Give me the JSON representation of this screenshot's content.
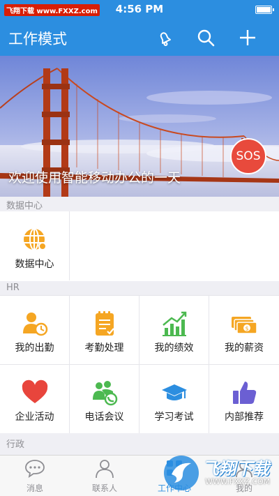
{
  "status_bar": {
    "carrier": "飞翔下载 www.FXXZ.com",
    "time": "4:56 PM",
    "battery_level": 1.0
  },
  "nav": {
    "title": "工作模式"
  },
  "banner": {
    "caption": "欢迎使用智能移动办公的一天",
    "sos_label": "SOS"
  },
  "sections": {
    "data_center": {
      "label": "数据中心",
      "items": [
        {
          "label": "数据中心",
          "icon": "globe-icon"
        }
      ]
    },
    "hr": {
      "label": "HR",
      "items": [
        {
          "label": "我的出勤",
          "icon": "attendance-icon"
        },
        {
          "label": "考勤处理",
          "icon": "clipboard-icon"
        },
        {
          "label": "我的绩效",
          "icon": "growth-chart-icon"
        },
        {
          "label": "我的薪资",
          "icon": "money-icon"
        },
        {
          "label": "企业活动",
          "icon": "heart-icon"
        },
        {
          "label": "电话会议",
          "icon": "conference-icon"
        },
        {
          "label": "学习考试",
          "icon": "graduation-cap-icon"
        },
        {
          "label": "内部推荐",
          "icon": "thumbs-up-icon"
        }
      ]
    },
    "admin": {
      "label": "行政"
    }
  },
  "tabs": [
    {
      "label": "消息",
      "icon": "chat-icon",
      "active": false
    },
    {
      "label": "联系人",
      "icon": "contact-icon",
      "active": false
    },
    {
      "label": "工作中心",
      "icon": "work-icon",
      "active": true
    },
    {
      "label": "我的",
      "icon": "profile-icon",
      "active": false
    }
  ],
  "watermark": {
    "text": "飞翔下载",
    "url": "WWW.FXXZ.COM"
  },
  "colors": {
    "primary": "#2c8ee0",
    "sos": "#e84a3c",
    "orange": "#f5a623",
    "green": "#4cb950",
    "red": "#e8453c",
    "purple": "#6b5fd3"
  }
}
